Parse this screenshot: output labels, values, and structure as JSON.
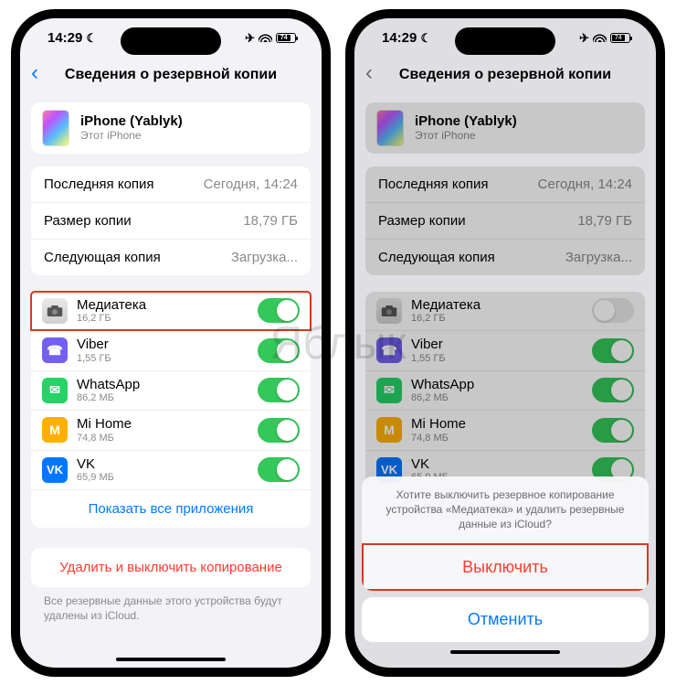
{
  "status": {
    "time": "14:29",
    "battery": "74"
  },
  "nav": {
    "title": "Сведения о резервной копии"
  },
  "device": {
    "name": "iPhone (Yablyk)",
    "sub": "Этот iPhone"
  },
  "info": {
    "last_label": "Последняя копия",
    "last_val": "Сегодня, 14:24",
    "size_label": "Размер копии",
    "size_val": "18,79 ГБ",
    "next_label": "Следующая копия",
    "next_val": "Загрузка..."
  },
  "apps": [
    {
      "name": "Медиатека",
      "size": "16,2 ГБ",
      "icon": "photos",
      "on_left": true,
      "on_right": false,
      "highlight_left": true
    },
    {
      "name": "Viber",
      "size": "1,55 ГБ",
      "icon": "viber",
      "on_left": true,
      "on_right": true
    },
    {
      "name": "WhatsApp",
      "size": "86,2 МБ",
      "icon": "wa",
      "on_left": true,
      "on_right": true
    },
    {
      "name": "Mi Home",
      "size": "74,8 МБ",
      "icon": "mi",
      "on_left": true,
      "on_right": true
    },
    {
      "name": "VK",
      "size": "65,9 МБ",
      "icon": "vk",
      "on_left": true,
      "on_right": true
    }
  ],
  "show_all": "Показать все приложения",
  "delete": "Удалить и выключить копирование",
  "footer": "Все резервные данные этого устройства будут удалены из iCloud.",
  "sheet": {
    "msg": "Хотите выключить резервное копирование устройства «Медиатека» и удалить резервные данные из iCloud?",
    "off": "Выключить",
    "cancel": "Отменить"
  },
  "watermark": "Яблык"
}
